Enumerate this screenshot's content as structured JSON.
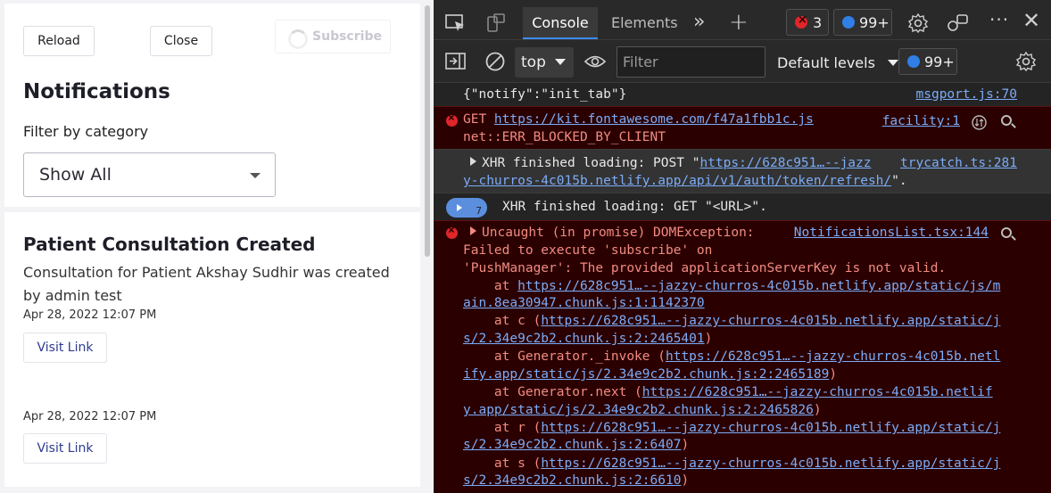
{
  "app": {
    "reload_label": "Reload",
    "close_label": "Close",
    "subscribe_label": "Subscribe",
    "title": "Notifications",
    "filter_label": "Filter by category",
    "filter_value": "Show All",
    "items": [
      {
        "title": "Patient Consultation Created",
        "description": "Consultation for Patient Akshay Sudhir was created by admin test",
        "date": "Apr 28, 2022 12:07 PM",
        "link_label": "Visit Link"
      },
      {
        "title": "",
        "description": "",
        "date": "Apr 28, 2022 12:07 PM",
        "link_label": "Visit Link"
      }
    ]
  },
  "devtools": {
    "tabs": {
      "console": "Console",
      "elements": "Elements"
    },
    "error_count": "3",
    "message_count": "99+",
    "toolbar": {
      "context": "top",
      "filter_placeholder": "Filter",
      "levels": "Default levels",
      "issues_count": "99+"
    },
    "log": {
      "r1_msg": "{\"notify\":\"init_tab\"}",
      "r1_src": "msgport.js:70",
      "r2_prefix": "GET ",
      "r2_url": "https://kit.fontawesome.com/f47a1fbb1c.js",
      "r2_line2": "net::ERR_BLOCKED_BY_CLIENT",
      "r2_src": "facility:1",
      "r3_prefix": "XHR finished loading: POST \"",
      "r3_url1": "https://628c951…--jazz",
      "r3_url2": "y-churros-4c015b.netlify.app/api/v1/auth/token/refresh/",
      "r3_suffix": "\".",
      "r3_src": "trycatch.ts:281",
      "r4_badge": "7",
      "r4_msg": "XHR finished loading: GET \"<URL>\".",
      "r5_line1": "Uncaught (in promise) DOMException:",
      "r5_line2": "Failed to execute 'subscribe' on",
      "r5_line3": "'PushManager': The provided applicationServerKey is not valid.",
      "r5_src": "NotificationsList.tsx:144",
      "s1_pre": "    at ",
      "s1_url_a": "https://628c951…--jazzy-churros-4c015b.netlify.app/static/js/m",
      "s1_url_b": "ain.8ea30947.chunk.js:1:1142370",
      "s2_pre": "    at c (",
      "s2_url_a": "https://628c951…--jazzy-churros-4c015b.netlify.app/static/j",
      "s2_url_b": "s/2.34e9c2b2.chunk.js:2:2465401",
      "s3_pre": "    at Generator._invoke (",
      "s3_url_a": "https://628c951…--jazzy-churros-4c015b.netl",
      "s3_url_b": "ify.app/static/js/2.34e9c2b2.chunk.js:2:2465189",
      "s4_pre": "    at Generator.next (",
      "s4_url_a": "https://628c951…--jazzy-churros-4c015b.netlif",
      "s4_url_b": "y.app/static/js/2.34e9c2b2.chunk.js:2:2465826",
      "s5_pre": "    at r (",
      "s5_url_a": "https://628c951…--jazzy-churros-4c015b.netlify.app/static/j",
      "s5_url_b": "s/2.34e9c2b2.chunk.js:2:6407",
      "s6_pre": "    at s (",
      "s6_url_a": "https://628c951…--jazzy-churros-4c015b.netlify.app/static/j",
      "s6_url_b": "s/2.34e9c2b2.chunk.js:2:6610",
      "close_paren": ")"
    }
  }
}
